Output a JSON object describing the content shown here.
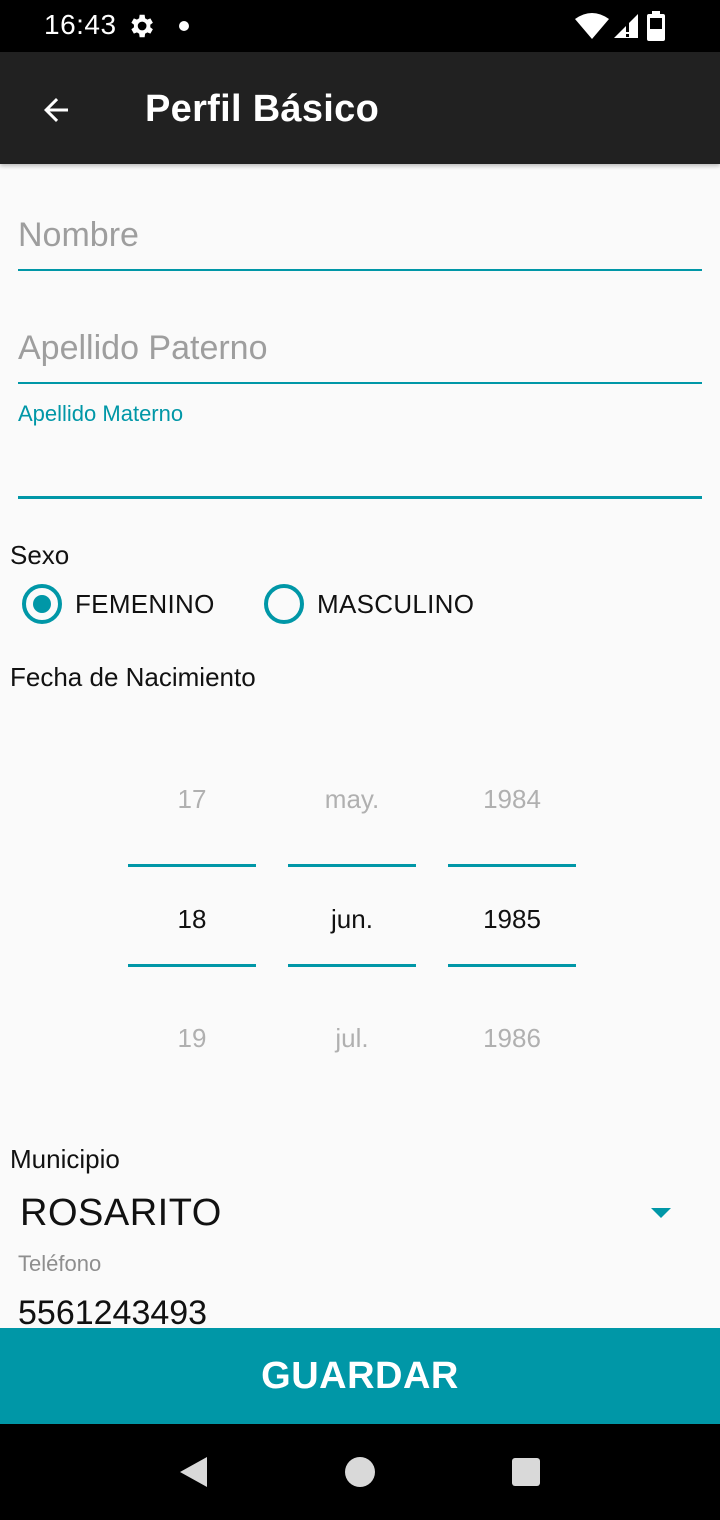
{
  "status_bar": {
    "time": "16:43"
  },
  "app_bar": {
    "title": "Perfil Básico"
  },
  "form": {
    "nombre": {
      "placeholder": "Nombre",
      "value": ""
    },
    "apellido_paterno": {
      "placeholder": "Apellido Paterno",
      "value": ""
    },
    "apellido_materno": {
      "label": "Apellido Materno",
      "value": ""
    },
    "sexo": {
      "label": "Sexo",
      "options": [
        {
          "label": "FEMENINO",
          "checked": true
        },
        {
          "label": "MASCULINO",
          "checked": false
        }
      ]
    },
    "fecha_nacimiento": {
      "label": "Fecha de Nacimiento",
      "day": {
        "prev": "17",
        "selected": "18",
        "next": "19"
      },
      "month": {
        "prev": "may.",
        "selected": "jun.",
        "next": "jul."
      },
      "year": {
        "prev": "1984",
        "selected": "1985",
        "next": "1986"
      }
    },
    "municipio": {
      "label": "Municipio",
      "value": "ROSARITO"
    },
    "telefono": {
      "label": "Teléfono",
      "value": "5561243493"
    }
  },
  "actions": {
    "save_label": "GUARDAR"
  },
  "colors": {
    "accent": "#0097a7",
    "app_bar": "#212121",
    "background": "#fafafa"
  }
}
